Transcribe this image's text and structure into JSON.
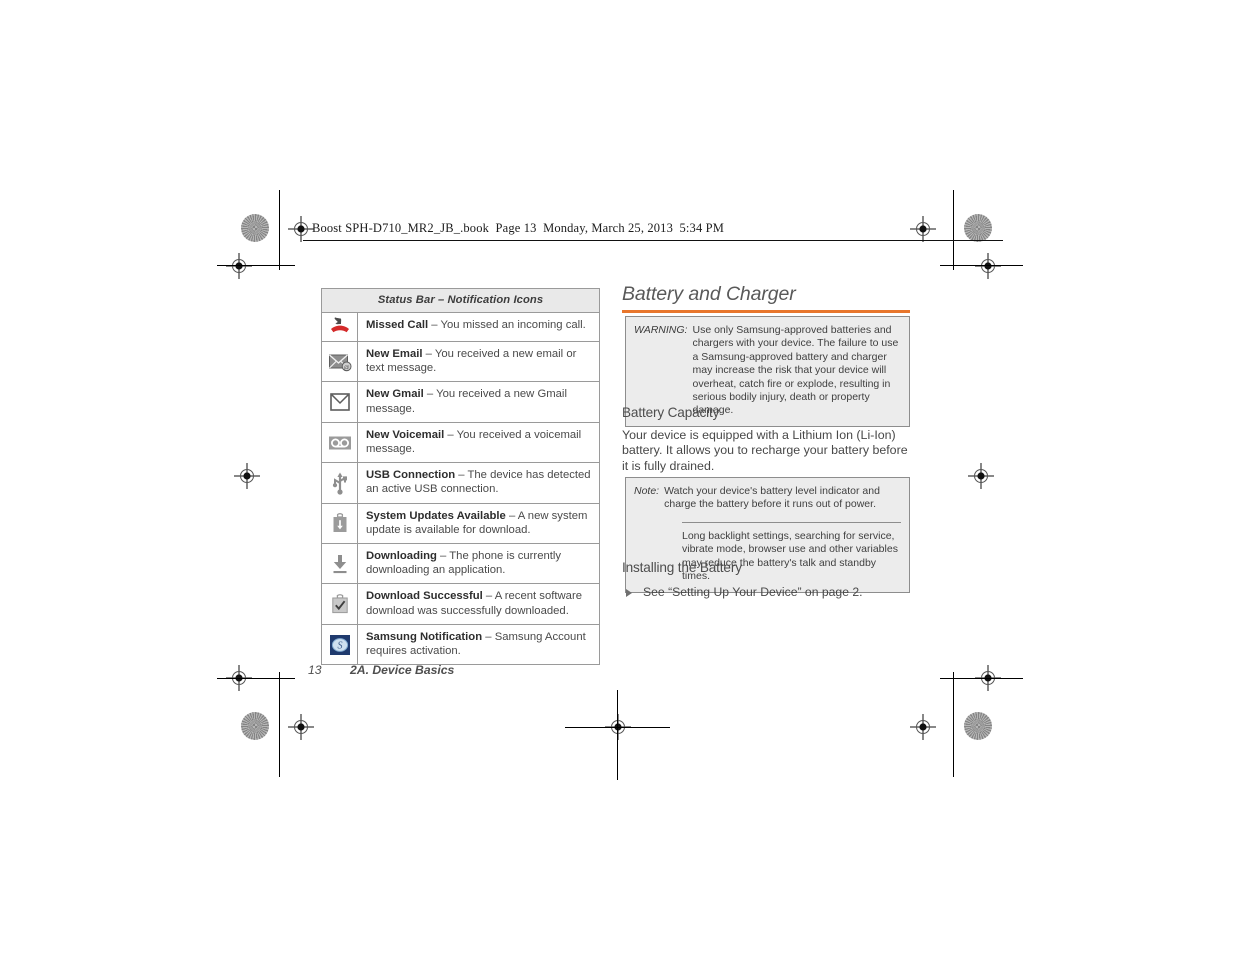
{
  "running_header": "Boost SPH-D710_MR2_JB_.book  Page 13  Monday, March 25, 2013  5:34 PM",
  "colors": {
    "accent_rule": "#e8762c",
    "table_header_fill": "#e9e9e9",
    "callout_fill": "#ececec",
    "table_border": "#9a9a9a",
    "missed_call_red": "#d42a2a",
    "samsung_blue": "#1f3a6e"
  },
  "icon_table": {
    "header": "Status Bar – Notification Icons",
    "rows": [
      {
        "icon": "missed-call-icon",
        "term": "Missed Call",
        "dash": " – ",
        "description": "You missed an incoming call."
      },
      {
        "icon": "new-email-icon",
        "term": "New Email",
        "dash": " – ",
        "description": "You received a new email or text message."
      },
      {
        "icon": "new-gmail-icon",
        "term": "New Gmail",
        "dash": " – ",
        "description": "You received a new Gmail message."
      },
      {
        "icon": "new-voicemail-icon",
        "term": "New Voicemail",
        "dash": " – ",
        "description": "You received a voicemail message."
      },
      {
        "icon": "usb-connection-icon",
        "term": "USB Connection",
        "dash": " – ",
        "description": "The device has detected an active USB connection."
      },
      {
        "icon": "system-updates-icon",
        "term": "System Updates Available",
        "dash": " – ",
        "description": "A new system update is available for download."
      },
      {
        "icon": "downloading-icon",
        "term": "Downloading",
        "dash": " – ",
        "description": "The phone is currently downloading an application."
      },
      {
        "icon": "download-successful-icon",
        "term": "Download Successful",
        "dash": " – ",
        "description": "A recent software download was successfully downloaded."
      },
      {
        "icon": "samsung-notification-icon",
        "term": "Samsung Notification",
        "dash": " – ",
        "description": "Samsung Account requires activation."
      }
    ]
  },
  "right_column": {
    "heading": "Battery and Charger",
    "warning": {
      "label": "WARNING:",
      "text": "Use only Samsung-approved batteries and chargers with your device. The failure to use a Samsung-approved battery and charger may increase the risk that your device will overheat, catch fire or explode, resulting in serious bodily injury, death or property damage."
    },
    "battery_capacity": {
      "heading": "Battery Capacity",
      "paragraph": "Your device is equipped with a Lithium Ion (Li-Ion) battery. It allows you to recharge your battery before it is fully drained."
    },
    "note": {
      "label": "Note:",
      "text": "Watch your device's battery level indicator and charge the battery before it runs out of power.",
      "text2": "Long backlight settings, searching for service, vibrate mode, browser use and other variables may reduce the battery's talk and standby times."
    },
    "installing_battery": {
      "heading": "Installing the Battery",
      "bullet": "See “Setting Up Your Device” on page 2."
    }
  },
  "footer": {
    "page_number": "13",
    "chapter": "2A. Device Basics"
  }
}
